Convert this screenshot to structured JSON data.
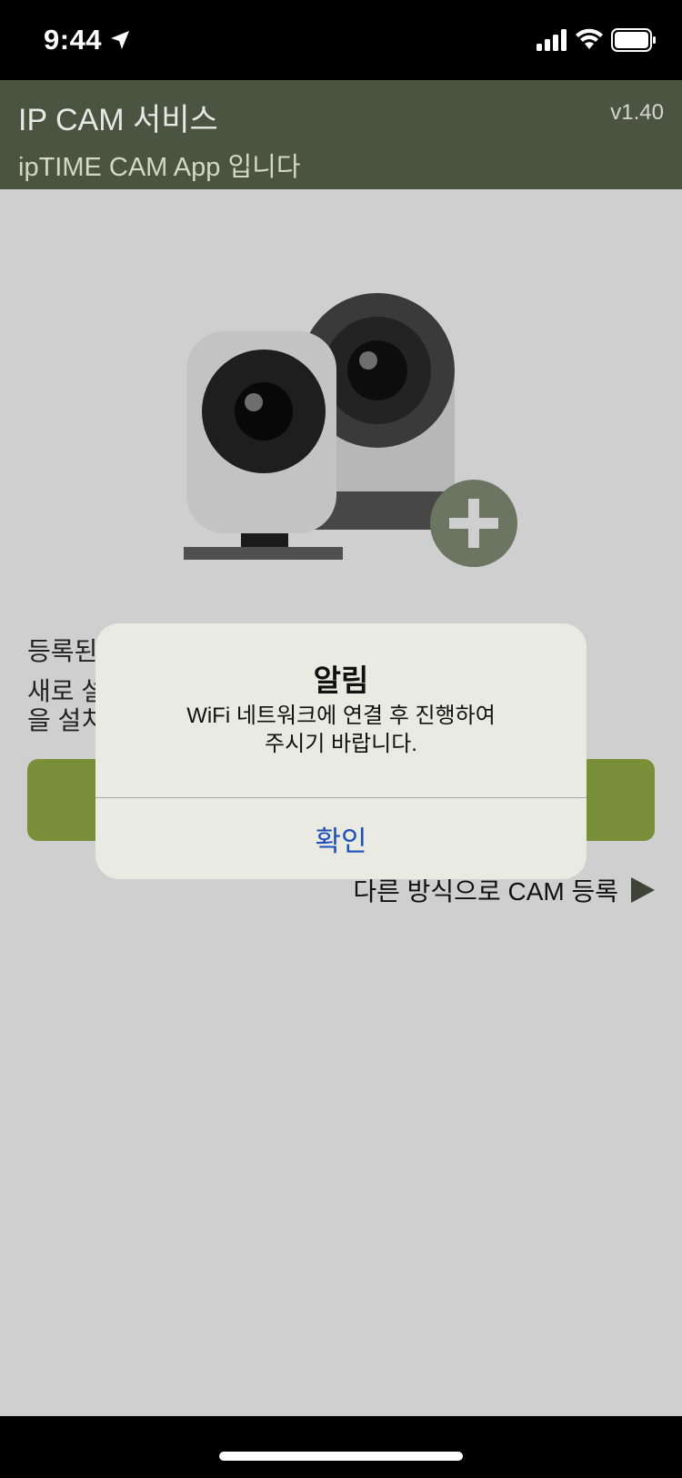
{
  "status_bar": {
    "time": "9:44"
  },
  "header": {
    "title": "IP CAM 서비스",
    "version": "v1.40",
    "subtitle": "ipTIME CAM App 입니다"
  },
  "main": {
    "line1_partial": "등록된",
    "line2_partial": "새로 설",
    "line3_partial": "을 설치",
    "alt_register_label": "다른 방식으로 CAM 등록"
  },
  "alert": {
    "title": "알림",
    "message_line1": "WiFi 네트워크에 연결 후 진행하여",
    "message_line2": "주시기 바랍니다.",
    "confirm_label": "확인"
  },
  "colors": {
    "header_bg": "#4a5440",
    "accent_button": "#7a8f3a",
    "link_blue": "#1f4fb8"
  }
}
